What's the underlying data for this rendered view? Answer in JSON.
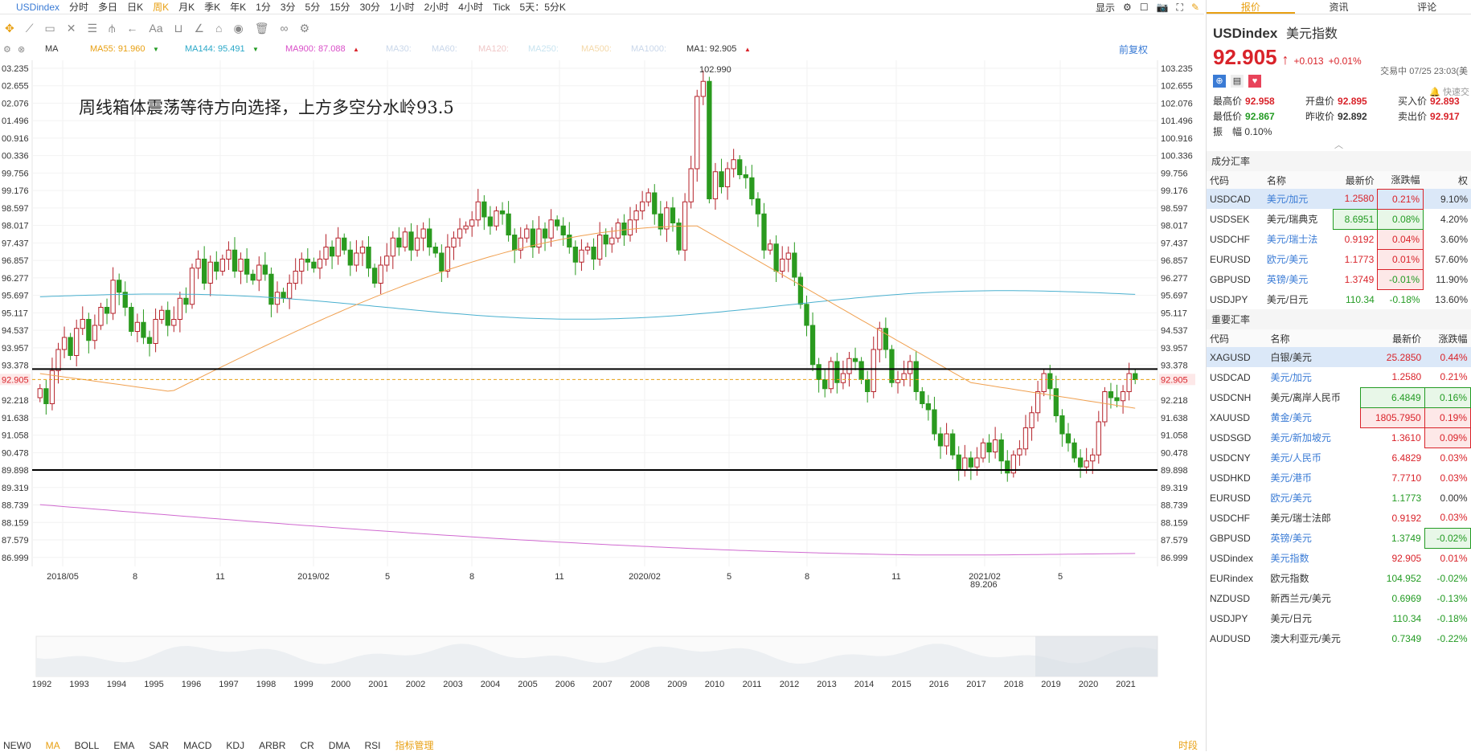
{
  "symbol": "USDindex",
  "periods": [
    "分时",
    "多日",
    "日K",
    "周K",
    "月K",
    "季K",
    "年K",
    "1分",
    "3分",
    "5分",
    "15分",
    "30分",
    "1小时",
    "2小时",
    "4小时",
    "Tick",
    "5天：5分K"
  ],
  "active_period": "周K",
  "top_right": {
    "display": "显示"
  },
  "ma_bar": [
    {
      "label": "MA",
      "color": "#333"
    },
    {
      "label": "MA55: 91.960",
      "color": "#e8a013",
      "dir": "down"
    },
    {
      "label": "MA144: 95.491",
      "color": "#2aa8c8",
      "dir": "down"
    },
    {
      "label": "MA900: 87.088",
      "color": "#d94ec8",
      "dir": "up"
    },
    {
      "label": "MA30:",
      "color": "#c9d7ea"
    },
    {
      "label": "MA60:",
      "color": "#c9d7ea"
    },
    {
      "label": "MA120:",
      "color": "#f0c8c8"
    },
    {
      "label": "MA250:",
      "color": "#c8e4f0"
    },
    {
      "label": "MA500:",
      "color": "#f4d8a8"
    },
    {
      "label": "MA1000:",
      "color": "#c9d7ea"
    },
    {
      "label": "MA1: 92.905",
      "color": "#333",
      "dir": "up"
    }
  ],
  "adjust_label": "前复权",
  "annotation": "周线箱体震荡等待方向选择，上方多空分水岭93.5",
  "chart_data": {
    "type": "candlestick",
    "yticks": [
      103.235,
      102.655,
      102.076,
      101.496,
      100.916,
      100.336,
      99.756,
      99.176,
      98.597,
      98.017,
      97.437,
      96.857,
      96.277,
      95.697,
      95.117,
      94.537,
      93.957,
      93.378,
      92.218,
      91.638,
      91.058,
      90.478,
      89.898,
      89.319,
      88.739,
      88.159,
      87.579,
      86.999
    ],
    "ylim": [
      86.7,
      103.5
    ],
    "xticks": [
      "2018/05",
      "8",
      "11",
      "2019/02",
      "5",
      "8",
      "11",
      "2020/02",
      "5",
      "8",
      "11",
      "2021/02",
      "5"
    ],
    "last_price": 92.905,
    "high_label": "102.990",
    "low_label": "89.206",
    "hlines": [
      93.25,
      89.9
    ],
    "navigator_years": [
      "1992",
      "1993",
      "1994",
      "1995",
      "1996",
      "1997",
      "1998",
      "1999",
      "2000",
      "2001",
      "2002",
      "2003",
      "2004",
      "2005",
      "2006",
      "2007",
      "2008",
      "2009",
      "2010",
      "2011",
      "2012",
      "2013",
      "2014",
      "2015",
      "2016",
      "2017",
      "2018",
      "2019",
      "2020",
      "2021"
    ],
    "closes": [
      92.6,
      92.1,
      93.2,
      93.9,
      94.3,
      93.7,
      94.6,
      94.9,
      94.2,
      94.7,
      95.3,
      95.1,
      96.2,
      95.8,
      95.3,
      94.5,
      94.8,
      94.3,
      94.1,
      94.9,
      95.2,
      94.7,
      94.9,
      95.6,
      95.4,
      96.6,
      96.9,
      96.1,
      96.8,
      96.5,
      96.9,
      97.2,
      96.5,
      96.9,
      96.4,
      96.2,
      96.7,
      96.4,
      95.4,
      95.8,
      95.6,
      96.1,
      96.5,
      96.9,
      96.8,
      96.6,
      96.9,
      97.3,
      97.0,
      97.6,
      97.2,
      96.7,
      97.1,
      97.3,
      96.6,
      96.1,
      96.7,
      97.0,
      97.6,
      97.3,
      97.8,
      97.2,
      97.6,
      97.9,
      97.3,
      97.1,
      96.5,
      97.3,
      97.6,
      97.9,
      98.0,
      98.2,
      98.8,
      98.3,
      98.0,
      98.5,
      98.4,
      97.7,
      97.2,
      97.6,
      97.9,
      97.3,
      97.9,
      97.6,
      98.2,
      98.0,
      97.7,
      97.3,
      96.8,
      97.2,
      97.3,
      96.9,
      97.7,
      97.4,
      97.6,
      98.1,
      97.7,
      98.2,
      98.5,
      98.8,
      99.1,
      98.4,
      97.9,
      98.6,
      98.1,
      97.2,
      98.8,
      99.9,
      102.3,
      102.8,
      98.9,
      99.8,
      99.3,
      99.9,
      100.2,
      99.7,
      99.6,
      98.9,
      98.4,
      97.2,
      97.4,
      96.5,
      96.9,
      97.1,
      96.3,
      95.4,
      94.7,
      93.4,
      92.9,
      92.6,
      93.5,
      92.8,
      93.1,
      93.6,
      93.5,
      92.9,
      92.5,
      93.9,
      94.6,
      93.9,
      92.8,
      92.9,
      93.1,
      93.5,
      92.5,
      92.1,
      91.9,
      91.1,
      90.7,
      91.1,
      90.4,
      89.9,
      90.3,
      90.0,
      90.3,
      90.8,
      90.5,
      90.9,
      90.2,
      89.8,
      90.4,
      90.6,
      91.3,
      91.8,
      92.5,
      93.1,
      92.6,
      91.7,
      91.1,
      90.8,
      90.3,
      90.0,
      90.2,
      90.4,
      91.5,
      92.5,
      92.3,
      92.2,
      92.5,
      93.1,
      92.9
    ]
  },
  "nav_strip": [
    "NEW0",
    "MA",
    "BOLL",
    "EMA",
    "SAR",
    "MACD",
    "KDJ",
    "ARBR",
    "CR",
    "DMA",
    "RSI",
    "指标管理"
  ],
  "nav_active": "MA",
  "nav_right": "时段",
  "panel": {
    "tabs": [
      "报价",
      "资讯",
      "评论"
    ],
    "name": "USDindex",
    "cn": "美元指数",
    "price": "92.905",
    "change": "+0.013",
    "pct": "+0.01%",
    "status": "交易中 07/25 23:03(美",
    "quick_trade": "快速交",
    "stats": [
      [
        "最高价",
        "92.958",
        "red"
      ],
      [
        "开盘价",
        "92.895",
        "red"
      ],
      [
        "买入价",
        "92.893",
        "red"
      ],
      [
        "最低价",
        "92.867",
        "green"
      ],
      [
        "昨收价",
        "92.892",
        "dark"
      ],
      [
        "卖出价",
        "92.917",
        "red"
      ]
    ],
    "amp_label": "振　幅",
    "amp": "0.10%",
    "comp_title": "成分汇率",
    "comp_head": [
      "代码",
      "名称",
      "最新价",
      "涨跌幅",
      "权"
    ],
    "comp": [
      [
        "USDCAD",
        "美元/加元",
        "1.2580",
        "0.21%",
        "9.10%",
        "r",
        "sel"
      ],
      [
        "USDSEK",
        "美元/瑞典克",
        "8.6951",
        "0.08%",
        "4.20%",
        "g",
        ""
      ],
      [
        "USDCHF",
        "美元/瑞士法",
        "0.9192",
        "0.04%",
        "3.60%",
        "r",
        ""
      ],
      [
        "EURUSD",
        "欧元/美元",
        "1.1773",
        "0.01%",
        "57.60%",
        "r",
        ""
      ],
      [
        "GBPUSD",
        "英镑/美元",
        "1.3749",
        "-0.01%",
        "11.90%",
        "r",
        ""
      ],
      [
        "USDJPY",
        "美元/日元",
        "110.34",
        "-0.18%",
        "13.60%",
        "n",
        ""
      ]
    ],
    "imp_title": "重要汇率",
    "imp_head": [
      "代码",
      "名称",
      "最新价",
      "涨跌幅"
    ],
    "imp": [
      [
        "XAGUSD",
        "白银/美元",
        "25.2850",
        "0.44%",
        "r",
        "sel"
      ],
      [
        "USDCAD",
        "美元/加元",
        "1.2580",
        "0.21%",
        "r",
        ""
      ],
      [
        "USDCNH",
        "美元/离岸人民币",
        "6.4849",
        "0.16%",
        "g",
        ""
      ],
      [
        "XAUUSD",
        "黄金/美元",
        "1805.7950",
        "0.19%",
        "rb",
        ""
      ],
      [
        "USDSGD",
        "美元/新加坡元",
        "1.3610",
        "0.09%",
        "rb2",
        ""
      ],
      [
        "USDCNY",
        "美元/人民币",
        "6.4829",
        "0.03%",
        "r",
        ""
      ],
      [
        "USDHKD",
        "美元/港币",
        "7.7710",
        "0.03%",
        "r",
        ""
      ],
      [
        "EURUSD",
        "欧元/美元",
        "1.1773",
        "0.00%",
        "n",
        ""
      ],
      [
        "USDCHF",
        "美元/瑞士法郎",
        "0.9192",
        "0.03%",
        "r",
        ""
      ],
      [
        "GBPUSD",
        "英镑/美元",
        "1.3749",
        "-0.02%",
        "gb",
        ""
      ],
      [
        "USDindex",
        "美元指数",
        "92.905",
        "0.01%",
        "r",
        ""
      ],
      [
        "EURindex",
        "欧元指数",
        "104.952",
        "-0.02%",
        "g",
        ""
      ],
      [
        "NZDUSD",
        "新西兰元/美元",
        "0.6969",
        "-0.13%",
        "g",
        ""
      ],
      [
        "USDJPY",
        "美元/日元",
        "110.34",
        "-0.18%",
        "g",
        ""
      ],
      [
        "AUDUSD",
        "澳大利亚元/美元",
        "0.7349",
        "-0.22%",
        "g",
        ""
      ]
    ]
  }
}
